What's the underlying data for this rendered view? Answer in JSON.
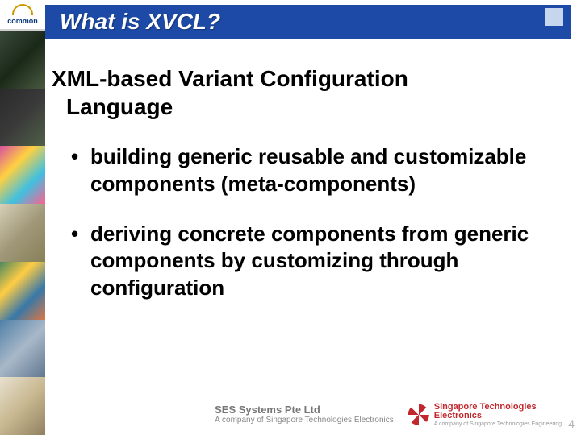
{
  "logo": {
    "text": "common"
  },
  "title": "What is XVCL?",
  "definition_line1": "XML-based Variant Configuration",
  "definition_line2": "Language",
  "bullets": [
    "building generic reusable and customizable components (meta-components)",
    "deriving concrete components from generic components by customizing through configuration"
  ],
  "footer": {
    "ses_line1": "SES Systems Pte Ltd",
    "ses_line2": "A company of Singapore Technologies Electronics",
    "ste_line1": "Singapore Technologies",
    "ste_line2": "Electronics",
    "ste_line3": "A company of Singapore Technologies Engineering"
  },
  "page_number": "4"
}
